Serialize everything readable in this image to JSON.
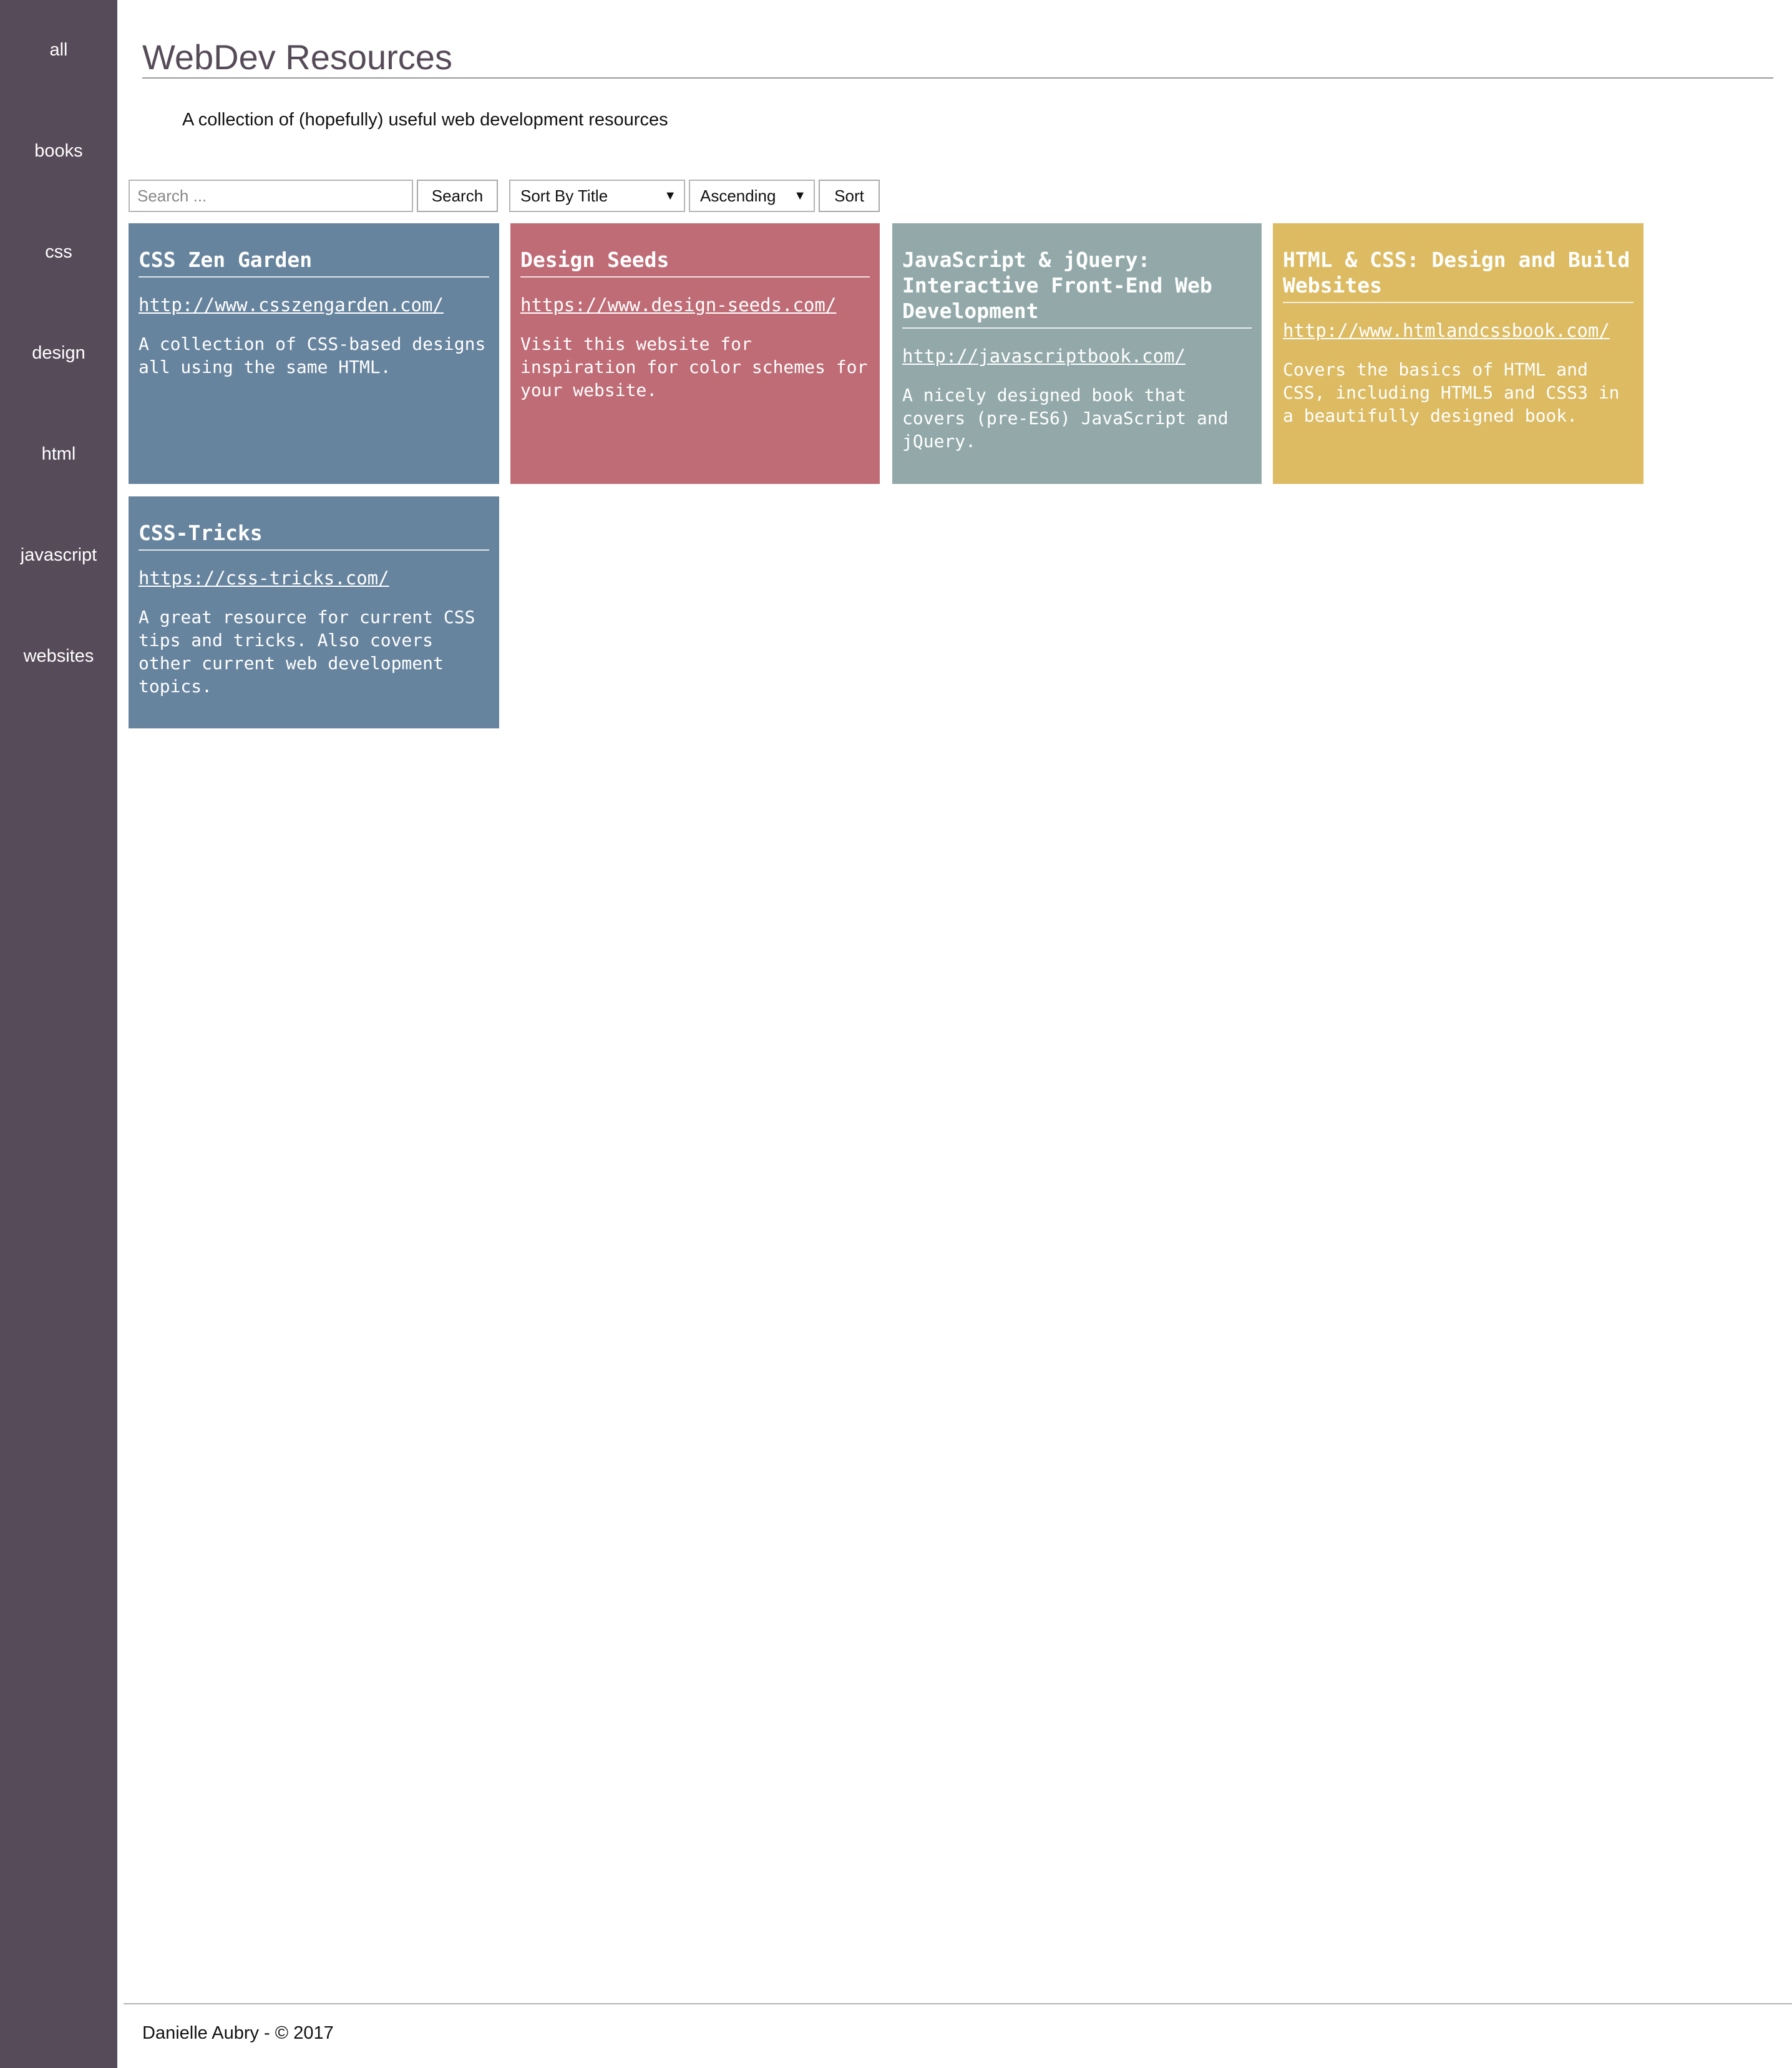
{
  "sidebar": {
    "items": [
      {
        "label": "all"
      },
      {
        "label": "books"
      },
      {
        "label": "css"
      },
      {
        "label": "design"
      },
      {
        "label": "html"
      },
      {
        "label": "javascript"
      },
      {
        "label": "websites"
      }
    ]
  },
  "header": {
    "title": "WebDev Resources",
    "subtitle": "A collection of (hopefully) useful web development resources"
  },
  "toolbar": {
    "search_placeholder": "Search ...",
    "search_label": "Search",
    "sort_field": "Sort By Title",
    "sort_order": "Ascending",
    "sort_label": "Sort"
  },
  "cards": [
    {
      "title": "CSS Zen Garden",
      "url": "http://www.csszengarden.com/",
      "description": "A collection of CSS-based designs all using the same HTML.",
      "color": "#67849e"
    },
    {
      "title": "Design Seeds",
      "url": "https://www.design-seeds.com/",
      "description": "Visit this website for inspiration for color schemes for your website.",
      "color": "#bf6c76"
    },
    {
      "title": "JavaScript & jQuery: Interactive Front-End Web Development",
      "url": "http://javascriptbook.com/",
      "description": "A nicely designed book that covers (pre-ES6) JavaScript and jQuery.",
      "color": "#93a9a9"
    },
    {
      "title": "HTML & CSS: Design and Build Websites",
      "url": "http://www.htmlandcssbook.com/",
      "description": "Covers the basics of HTML and CSS, including HTML5 and CSS3 in a beautifully designed book.",
      "color": "#dcbb63"
    },
    {
      "title": "CSS-Tricks",
      "url": "https://css-tricks.com/",
      "description": "A great resource for current CSS tips and tricks. Also covers other current web development topics.",
      "color": "#67849e"
    }
  ],
  "footer": {
    "text": "Danielle Aubry - © 2017"
  },
  "colors": {
    "sidebar": "#564b58",
    "title": "#564b58"
  }
}
